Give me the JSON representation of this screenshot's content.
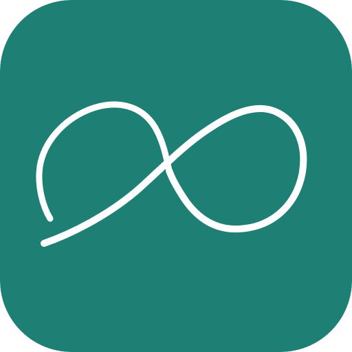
{
  "app_icon": {
    "icon": "infinity-icon",
    "colors": {
      "background": "#1e7f75",
      "glyph": "#ffffff"
    }
  }
}
